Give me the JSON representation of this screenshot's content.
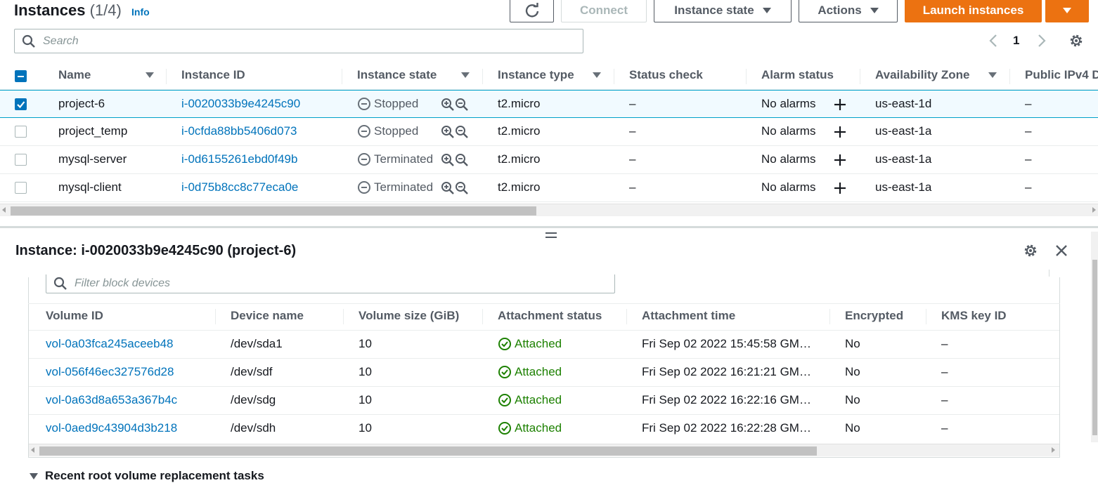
{
  "header": {
    "title": "Instances",
    "count": "(1/4)",
    "info": "Info",
    "connect_label": "Connect",
    "instance_state_label": "Instance state",
    "actions_label": "Actions",
    "launch_label": "Launch instances"
  },
  "search": {
    "placeholder": "Search"
  },
  "pagination": {
    "page": "1"
  },
  "table": {
    "columns": [
      "Name",
      "Instance ID",
      "Instance state",
      "Instance type",
      "Status check",
      "Alarm status",
      "Availability Zone",
      "Public IPv4 D"
    ],
    "rows": [
      {
        "name": "project-6",
        "id": "i-0020033b9e4245c90",
        "state": "Stopped",
        "type": "t2.micro",
        "status": "–",
        "alarm": "No alarms",
        "az": "us-east-1d",
        "ipv4": "–",
        "selected": true
      },
      {
        "name": "project_temp",
        "id": "i-0cfda88bb5406d073",
        "state": "Stopped",
        "type": "t2.micro",
        "status": "–",
        "alarm": "No alarms",
        "az": "us-east-1a",
        "ipv4": "–",
        "selected": false
      },
      {
        "name": "mysql-server",
        "id": "i-0d6155261ebd0f49b",
        "state": "Terminated",
        "type": "t2.micro",
        "status": "–",
        "alarm": "No alarms",
        "az": "us-east-1a",
        "ipv4": "–",
        "selected": false
      },
      {
        "name": "mysql-client",
        "id": "i-0d75b8cc8c77eca0e",
        "state": "Terminated",
        "type": "t2.micro",
        "status": "–",
        "alarm": "No alarms",
        "az": "us-east-1a",
        "ipv4": "–",
        "selected": false
      }
    ]
  },
  "panel": {
    "title": "Instance: i-0020033b9e4245c90 (project-6)",
    "filter_placeholder": "Filter block devices",
    "columns": [
      "Volume ID",
      "Device name",
      "Volume size (GiB)",
      "Attachment status",
      "Attachment time",
      "Encrypted",
      "KMS key ID"
    ],
    "volumes": [
      {
        "id": "vol-0a03fca245aceeb48",
        "device": "/dev/sda1",
        "size": "10",
        "status": "Attached",
        "time": "Fri Sep 02 2022 15:45:58 GM…",
        "encrypted": "No",
        "kms": "–"
      },
      {
        "id": "vol-056f46ec327576d28",
        "device": "/dev/sdf",
        "size": "10",
        "status": "Attached",
        "time": "Fri Sep 02 2022 16:21:21 GM…",
        "encrypted": "No",
        "kms": "–"
      },
      {
        "id": "vol-0a63d8a653a367b4c",
        "device": "/dev/sdg",
        "size": "10",
        "status": "Attached",
        "time": "Fri Sep 02 2022 16:22:16 GM…",
        "encrypted": "No",
        "kms": "–"
      },
      {
        "id": "vol-0aed9c43904d3b218",
        "device": "/dev/sdh",
        "size": "10",
        "status": "Attached",
        "time": "Fri Sep 02 2022 16:22:28 GM…",
        "encrypted": "No",
        "kms": "–"
      }
    ],
    "recent_label": "Recent root volume replacement tasks"
  },
  "colors": {
    "link": "#0073bb",
    "primary": "#ec7211",
    "success": "#1d8102",
    "selected_bg": "#f1faff"
  },
  "icons": [
    "refresh-icon",
    "search-icon",
    "chevron-left-icon",
    "chevron-right-icon",
    "gear-icon",
    "stopped-icon",
    "zoom-in-icon",
    "zoom-out-icon",
    "plus-icon",
    "check-circle-icon",
    "close-icon",
    "drag-handle-icon",
    "caret-down-icon"
  ]
}
